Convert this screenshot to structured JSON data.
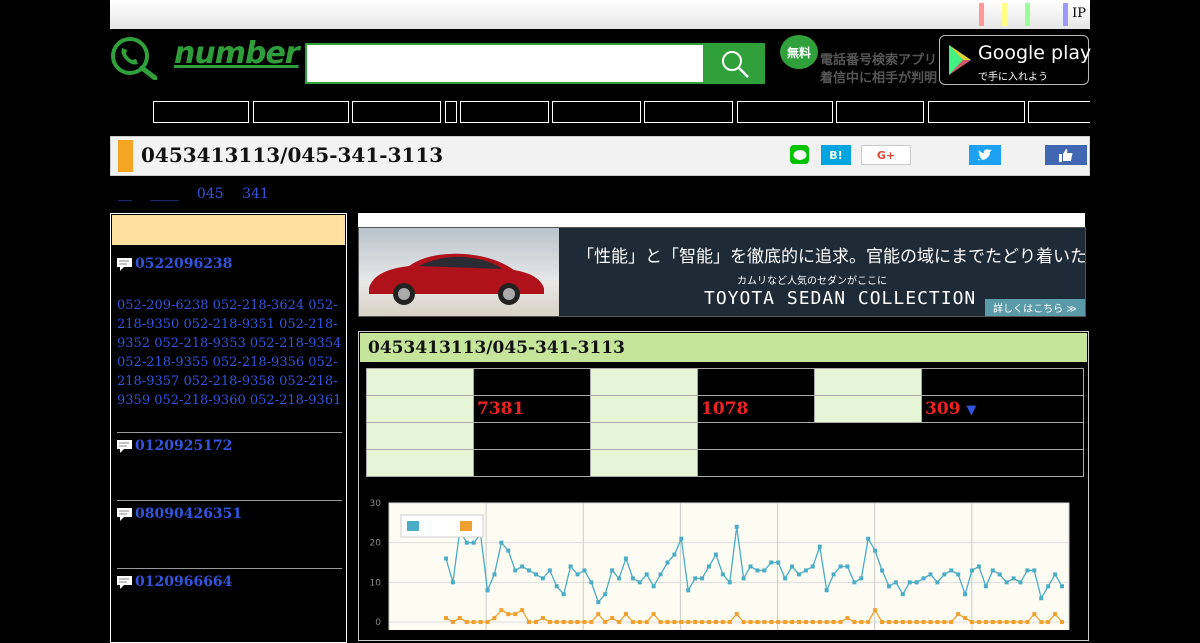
{
  "topbar": {
    "ip_label": "IP",
    "stripe_colors": [
      "#ff9999",
      "#ffff88",
      "#99ff99",
      "#9999ff"
    ]
  },
  "header": {
    "logo_text": "number",
    "search": {
      "value": "",
      "placeholder": ""
    },
    "app_promo": {
      "badge": "無料",
      "line1": "電話番号検索アプリ",
      "line2": "着信中に相手が判明"
    },
    "google_play": {
      "main": "Google play",
      "sub": "で手に入れよう"
    }
  },
  "nav": {
    "count": 10
  },
  "title_bar": {
    "title": "0453413113/045-341-3113",
    "share": {
      "hatena": "B!",
      "gplus": "G+"
    }
  },
  "breadcrumb": [
    "__",
    "____",
    "045",
    "341"
  ],
  "sidebar": {
    "entries": [
      {
        "number": "0522096238",
        "related": [
          "052-209-6238",
          "052-218-3624",
          "052-218-9350",
          "052-218-9351",
          "052-218-9352",
          "052-218-9353",
          "052-218-9354",
          "052-218-9355",
          "052-218-9356",
          "052-218-9357",
          "052-218-9358",
          "052-218-9359",
          "052-218-9360",
          "052-218-9361"
        ]
      },
      {
        "number": "0120925172",
        "related": []
      },
      {
        "number": "08090426351",
        "related": []
      },
      {
        "number": "0120966664",
        "related": []
      }
    ]
  },
  "banner": {
    "line1": "「性能」と「智能」を徹底的に追求。官能の域にまでたどり着いた。",
    "line2": "カムリなど人気のセダンがここに",
    "line3": "TOYOTA SEDAN COLLECTION",
    "cta": "詳しくはこちら ≫"
  },
  "panel": {
    "title": "0453413113/045-341-3113",
    "stats": {
      "v1": "7381",
      "v2": "1078",
      "v3": "309",
      "v3_arrow": "▼"
    }
  },
  "chart_data": {
    "type": "line",
    "ylim": [
      0,
      30
    ],
    "yticks": [
      "0",
      "10",
      "20",
      "30"
    ],
    "colors": [
      "#4bacc6",
      "#f0a030"
    ],
    "series": [
      {
        "values": [
          16,
          10,
          23,
          20,
          20,
          22,
          8,
          12,
          20,
          18,
          13,
          14,
          13,
          12,
          11,
          13,
          9,
          7,
          14,
          12,
          13,
          10,
          5,
          7,
          13,
          11,
          16,
          11,
          10,
          12,
          9,
          12,
          15,
          17,
          21,
          8,
          11,
          11,
          14,
          17,
          12,
          10,
          24,
          11,
          14,
          13,
          13,
          15,
          15,
          11,
          14,
          12,
          13,
          14,
          19,
          8,
          12,
          14,
          14,
          10,
          11,
          21,
          18,
          13,
          9,
          10,
          7,
          10,
          10,
          11,
          12,
          10,
          12,
          13,
          12,
          7,
          13,
          14,
          9,
          13,
          12,
          10,
          11,
          10,
          13,
          13,
          6,
          9,
          12,
          9
        ]
      },
      {
        "values": [
          1,
          0,
          1,
          0,
          0,
          0,
          0,
          1,
          3,
          2,
          2,
          3,
          0,
          0,
          1,
          0,
          0,
          0,
          0,
          0,
          0,
          0,
          2,
          0,
          1,
          0,
          2,
          0,
          0,
          0,
          2,
          0,
          0,
          0,
          0,
          0,
          0,
          0,
          0,
          0,
          0,
          0,
          2,
          0,
          0,
          0,
          0,
          0,
          0,
          0,
          0,
          0,
          0,
          0,
          0,
          0,
          0,
          0,
          1,
          0,
          0,
          0,
          3,
          0,
          0,
          0,
          0,
          0,
          0,
          0,
          0,
          0,
          0,
          0,
          2,
          1,
          0,
          0,
          0,
          0,
          0,
          0,
          0,
          0,
          0,
          2,
          0,
          0,
          2,
          0
        ]
      }
    ]
  }
}
